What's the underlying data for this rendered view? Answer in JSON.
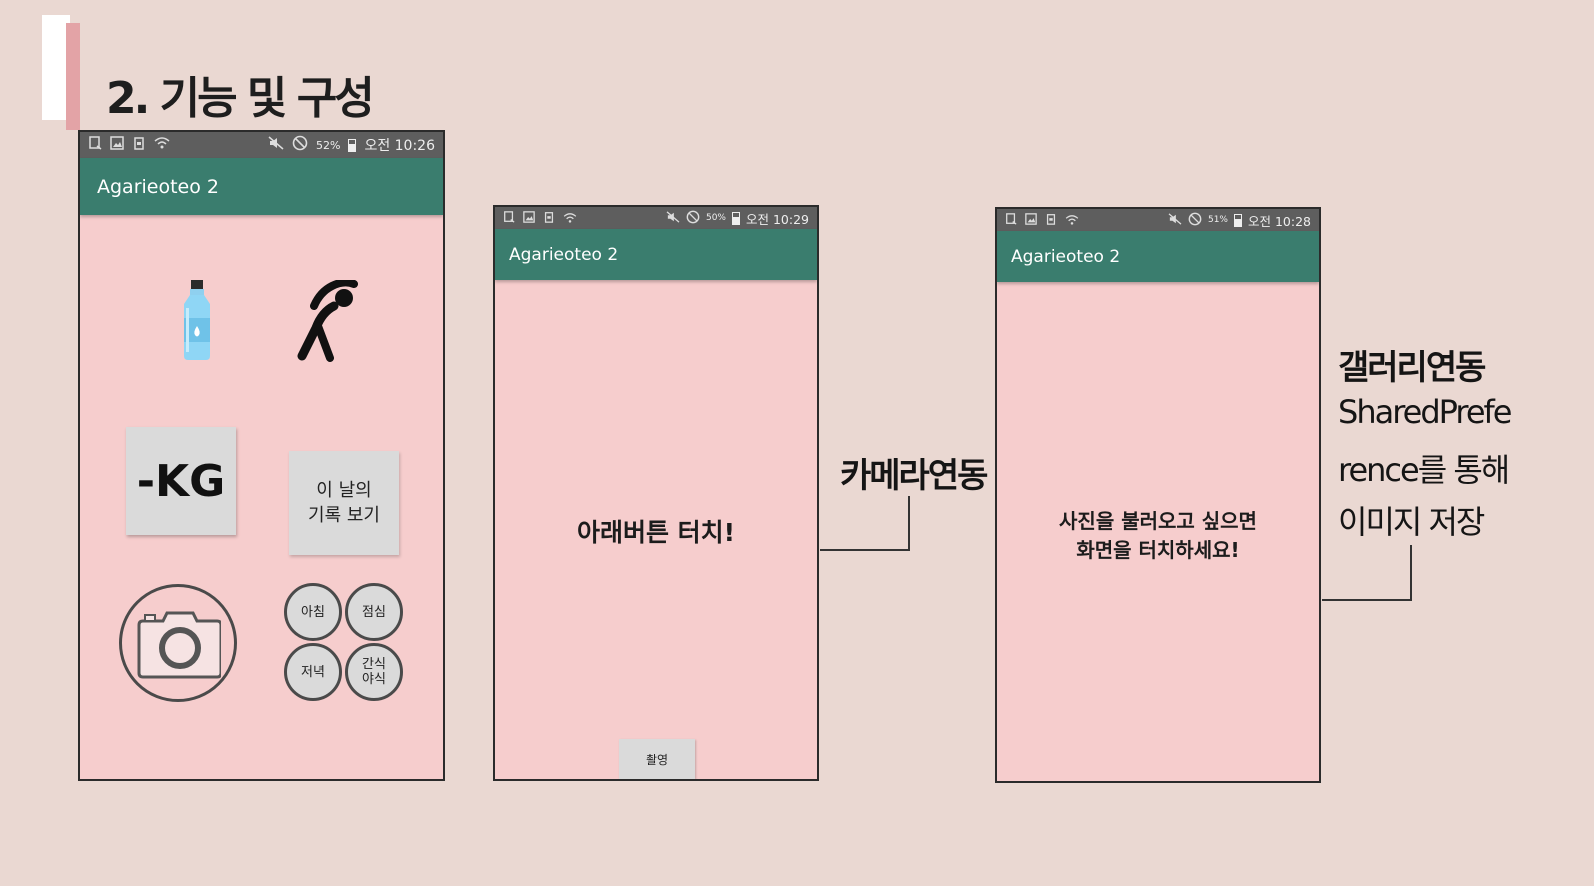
{
  "slide": {
    "title": "2. 기능 및 구성"
  },
  "phones": [
    {
      "status": {
        "battery": "52%",
        "time": "오전 10:26"
      },
      "app_title": "Agarieoteo 2",
      "kg_label": "-KG",
      "record_label": "이 날의\n기록 보기",
      "meals": [
        "아침",
        "점심",
        "저녁",
        "간식\n야식"
      ]
    },
    {
      "status": {
        "battery": "50%",
        "time": "오전 10:29"
      },
      "app_title": "Agarieoteo 2",
      "message": "아래버튼 터치!",
      "button_label": "촬영"
    },
    {
      "status": {
        "battery": "51%",
        "time": "오전 10:28"
      },
      "app_title": "Agarieoteo 2",
      "message_line1": "사진을 불러오고 싶으면",
      "message_line2": "화면을 터치하세요!"
    }
  ],
  "callouts": {
    "camera": "카메라연동",
    "gallery": [
      "갤러리연동",
      "SharedPrefe",
      "rence를 통해",
      "이미지 저장"
    ]
  },
  "icons": [
    "notification-icon",
    "image-icon",
    "clipboard-icon",
    "wifi-icon",
    "mute-icon",
    "blocked-icon",
    "battery-icon",
    "water-bottle-icon",
    "stretching-person-icon",
    "camera-icon"
  ],
  "colors": {
    "background": "#ead8d2",
    "app_bar": "#3a7d6e",
    "screen_bg": "#f6cdcd",
    "status_bar": "#5e5e5e",
    "accent": "#e3a3a6"
  }
}
